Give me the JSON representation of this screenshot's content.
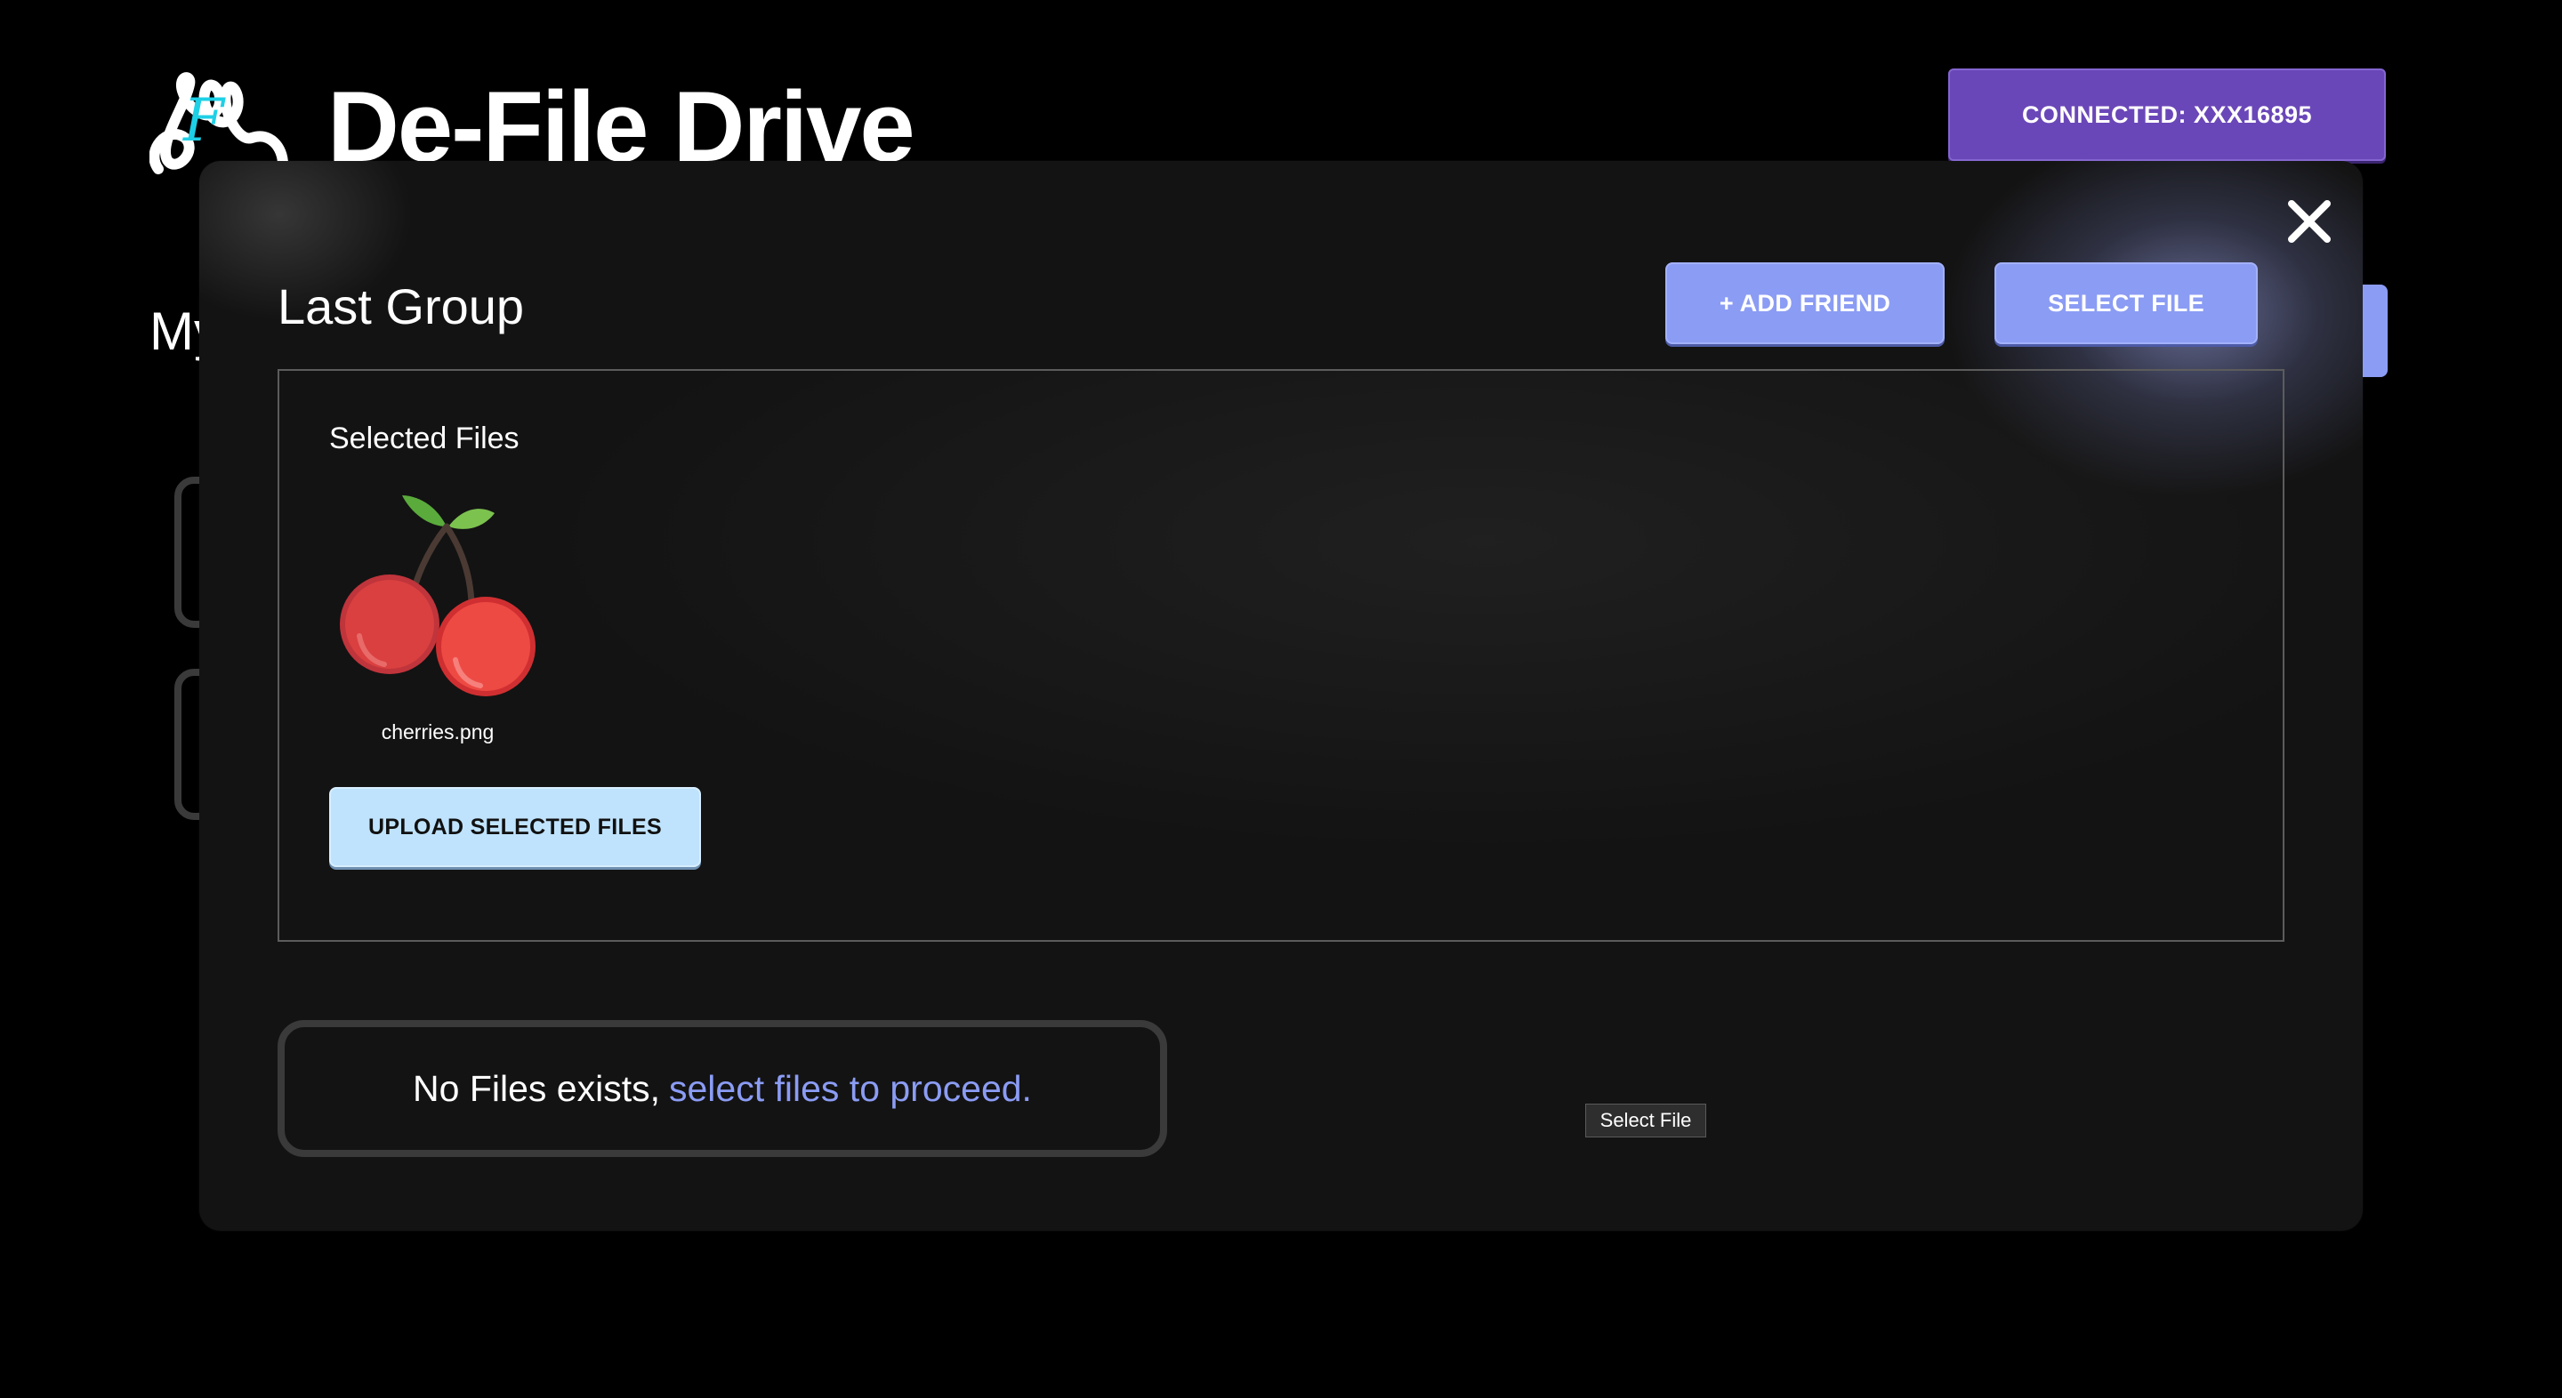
{
  "app": {
    "title": "De-File Drive",
    "connect_button_label": "CONNECTED: XXX16895",
    "background_heading": "My"
  },
  "modal": {
    "title": "Last Group",
    "add_friend_label": "+ ADD FRIEND",
    "select_file_label": "SELECT FILE",
    "close_icon": "close-icon",
    "selected_files_label": "Selected Files",
    "selected_files": [
      {
        "name": "cherries.png",
        "icon": "cherries-icon"
      }
    ],
    "upload_button_label": "UPLOAD SELECTED FILES",
    "empty_state": {
      "text": "No Files exists,",
      "link": "select files to proceed."
    },
    "native_select_label": "Select File"
  },
  "colors": {
    "accent_lavender": "#8b9cf4",
    "connect_purple": "#6a47b8",
    "upload_light_blue": "#bfe3fd",
    "logo_cyan": "#1ed0e6",
    "modal_bg": "#131313"
  }
}
